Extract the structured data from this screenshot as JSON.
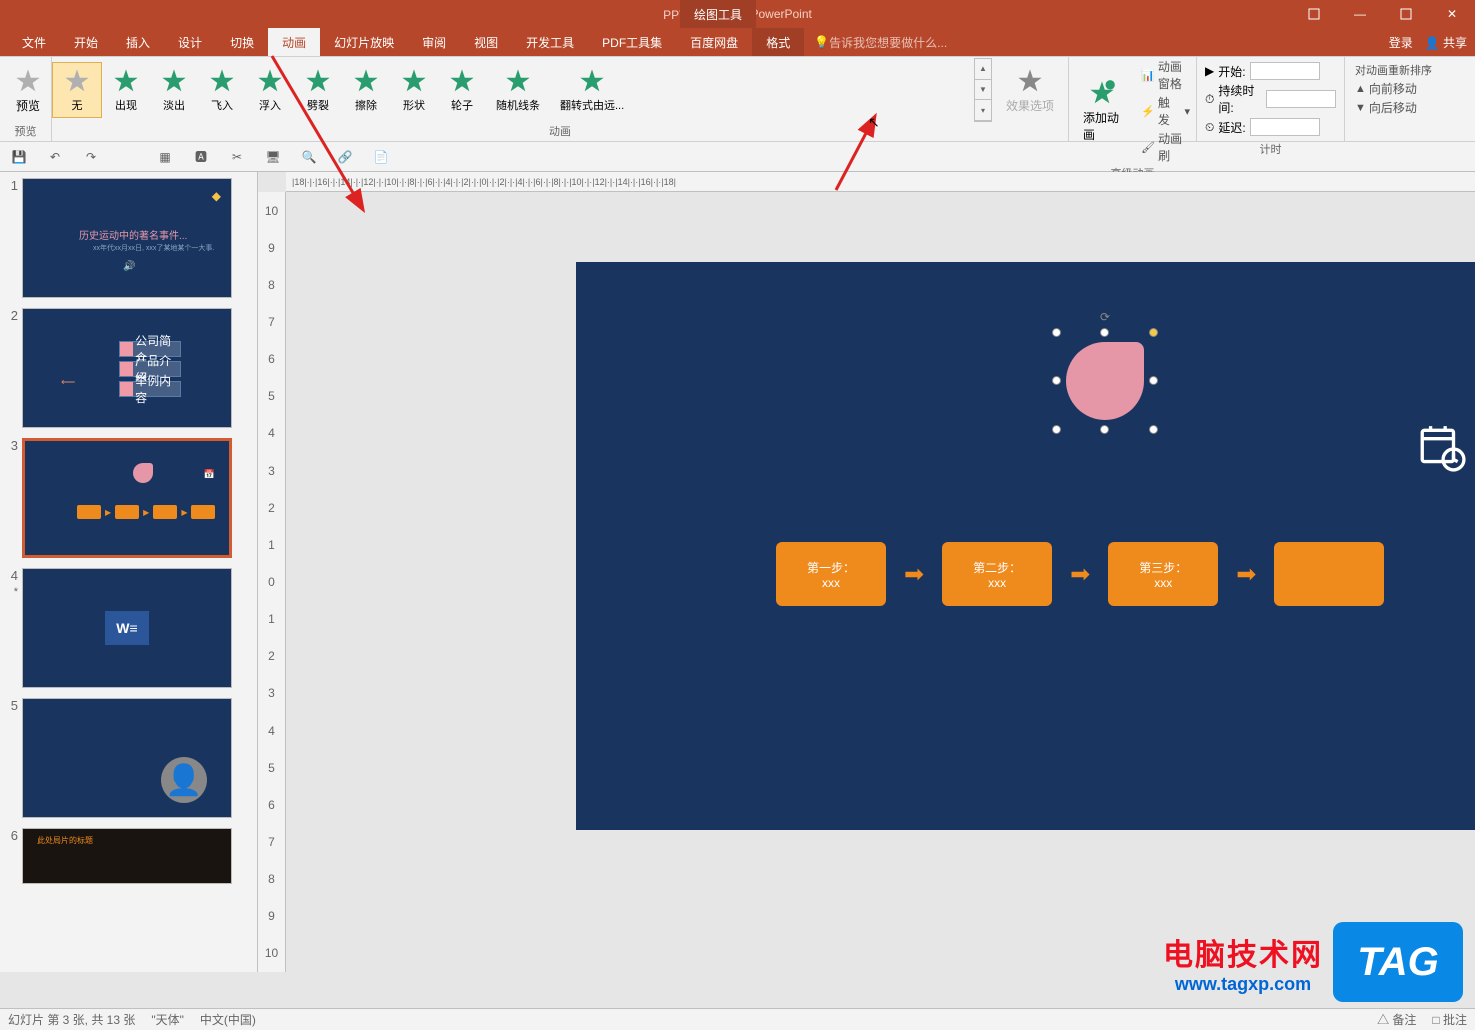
{
  "title": {
    "filename": "PPT教程2.pptx",
    "app": " - PowerPoint"
  },
  "drawing_tools": "绘图工具",
  "win": {
    "ribbon_display": "▢",
    "min": "—",
    "max": "▢",
    "close": "✕"
  },
  "tabs": {
    "file": "文件",
    "home": "开始",
    "insert": "插入",
    "design": "设计",
    "transition": "切换",
    "animation": "动画",
    "slideshow": "幻灯片放映",
    "review": "审阅",
    "view": "视图",
    "dev": "开发工具",
    "pdf": "PDF工具集",
    "baidu": "百度网盘",
    "format": "格式"
  },
  "tell_me": {
    "icon": "💡",
    "text": "告诉我您想要做什么..."
  },
  "share": {
    "login": "登录",
    "share": "共享"
  },
  "ribbon": {
    "preview": {
      "label": "预览",
      "group": "预览"
    },
    "animations": {
      "group": "动画",
      "items": [
        {
          "name": "无"
        },
        {
          "name": "出现"
        },
        {
          "name": "淡出"
        },
        {
          "name": "飞入"
        },
        {
          "name": "浮入"
        },
        {
          "name": "劈裂"
        },
        {
          "name": "擦除"
        },
        {
          "name": "形状"
        },
        {
          "name": "轮子"
        },
        {
          "name": "随机线条"
        },
        {
          "name": "翻转式由远..."
        }
      ],
      "effect_options": "效果选项"
    },
    "advanced": {
      "group": "高级动画",
      "add": "添加动画",
      "pane": "动画窗格",
      "trigger": "触发",
      "painter": "动画刷"
    },
    "timing": {
      "group": "计时",
      "start": "开始:",
      "duration": "持续时间:",
      "delay": "延迟:",
      "reorder": "对动画重新排序",
      "earlier": "向前移动",
      "later": "向后移动"
    }
  },
  "slide": {
    "steps": [
      {
        "title": "第一步：",
        "sub": "xxx"
      },
      {
        "title": "第二步：",
        "sub": "xxx"
      },
      {
        "title": "第三步：",
        "sub": "xxx"
      },
      {
        "title": "",
        "sub": ""
      }
    ]
  },
  "panel_slides": [
    "1",
    "2",
    "3",
    "4",
    "5",
    "6"
  ],
  "thumb1": {
    "title": "历史运动中的著名事件...",
    "sub": "xx年代xx月xx日, xxx了某地某个一大事."
  },
  "thumb2": {
    "items": [
      "公司简介",
      "产品介绍",
      "举例内容"
    ]
  },
  "thumb4_star": "*",
  "thumb6_title": "此处局片的标题",
  "ruler_h": "|18|·|·|16|·|·|14|·|·|12|·|·|10|·|·|8|·|·|6|·|·|4|·|·|2|·|·|0|·|·|2|·|·|4|·|·|6|·|·|8|·|·|10|·|·|12|·|·|14|·|·|16|·|·|18|",
  "ruler_v": [
    "10",
    "9",
    "8",
    "7",
    "6",
    "5",
    "4",
    "3",
    "2",
    "1",
    "0",
    "1",
    "2",
    "3",
    "4",
    "5",
    "6",
    "7",
    "8",
    "9",
    "10"
  ],
  "status": {
    "slide": "幻灯片 第 3 张, 共 13 张",
    "theme": "\"天体\"",
    "lang": "中文(中国)",
    "notes": "△ 备注",
    "comments": "□ 批注"
  },
  "watermark": {
    "red": "电脑技术网",
    "blue": "www.tagxp.com",
    "tag": "TAG"
  }
}
